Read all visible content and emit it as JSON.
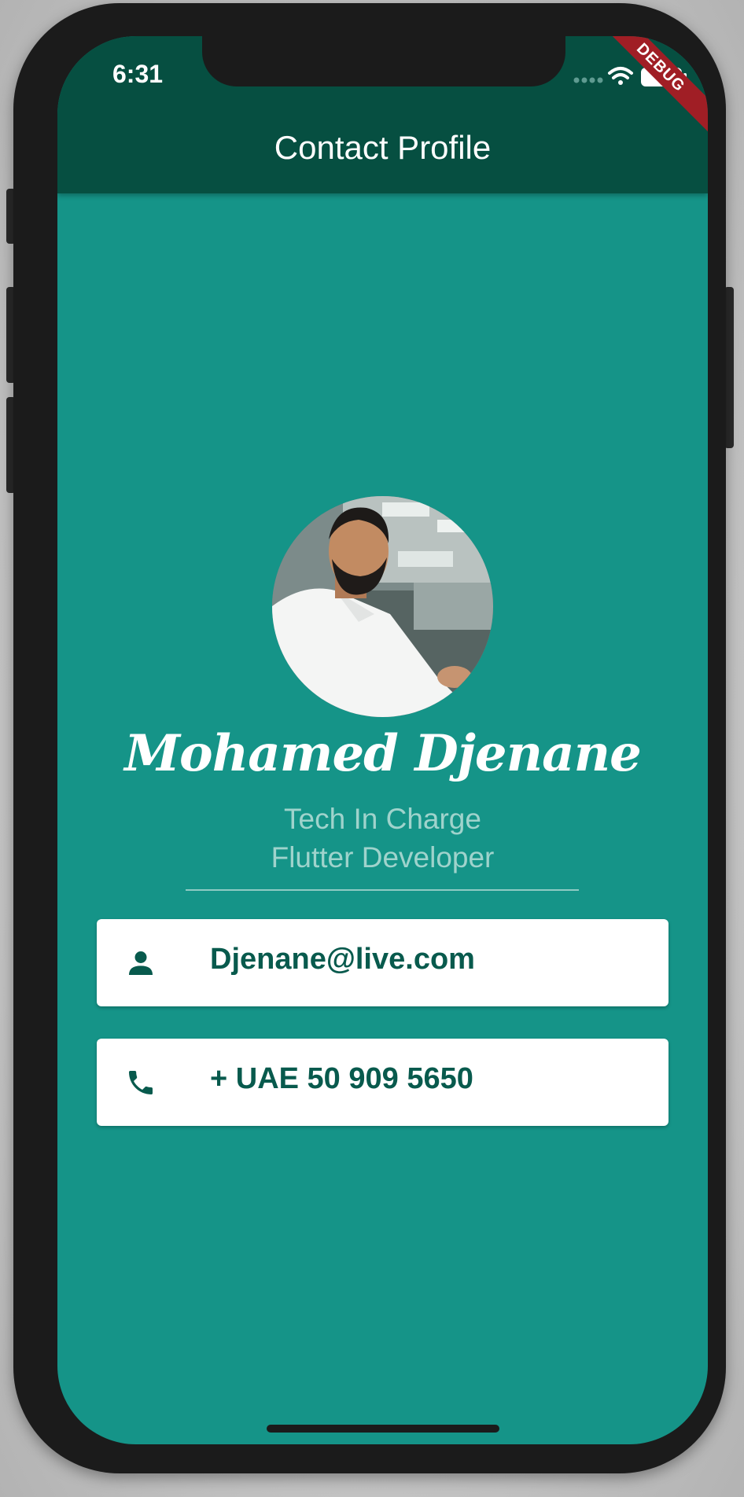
{
  "status_bar": {
    "time": "6:31",
    "debug_label": "DEBUG",
    "icons": [
      "cellular-signal-icon",
      "wifi-icon",
      "battery-icon"
    ]
  },
  "app_bar": {
    "title": "Contact Profile"
  },
  "profile": {
    "avatar_icon": "profile-photo",
    "name": "Mohamed Djenane",
    "role_line_1": "Tech In Charge",
    "role_line_2": "Flutter Developer"
  },
  "contacts": [
    {
      "icon": "person-icon",
      "text": "Djenane@live.com"
    },
    {
      "icon": "phone-icon",
      "text": "+ UAE 50 909 5650"
    }
  ],
  "colors": {
    "app_bar": "#064f41",
    "background": "#159488",
    "card": "#ffffff",
    "card_text": "#085a4d",
    "subtitle": "#9fd3cc",
    "debug_ribbon": "#a01e25"
  }
}
